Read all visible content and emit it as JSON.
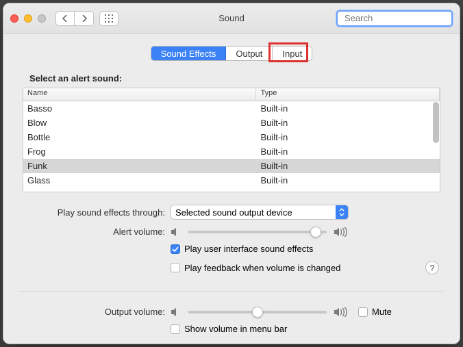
{
  "window": {
    "title": "Sound"
  },
  "search": {
    "placeholder": "Search"
  },
  "tabs": [
    "Sound Effects",
    "Output",
    "Input"
  ],
  "active_tab": 0,
  "highlight_tab": 2,
  "heading": "Select an alert sound:",
  "columns": {
    "name": "Name",
    "type": "Type"
  },
  "sounds": [
    {
      "name": "Basso",
      "type": "Built-in",
      "selected": false
    },
    {
      "name": "Blow",
      "type": "Built-in",
      "selected": false
    },
    {
      "name": "Bottle",
      "type": "Built-in",
      "selected": false
    },
    {
      "name": "Frog",
      "type": "Built-in",
      "selected": false
    },
    {
      "name": "Funk",
      "type": "Built-in",
      "selected": true
    },
    {
      "name": "Glass",
      "type": "Built-in",
      "selected": false
    }
  ],
  "labels": {
    "play_through": "Play sound effects through:",
    "alert_volume": "Alert volume:",
    "output_volume": "Output volume:"
  },
  "popup": {
    "selected": "Selected sound output device"
  },
  "alert_volume_pct": 92,
  "output_volume_pct": 50,
  "checkboxes": {
    "ui_effects": {
      "label": "Play user interface sound effects",
      "checked": true
    },
    "feedback": {
      "label": "Play feedback when volume is changed",
      "checked": false
    },
    "mute": {
      "label": "Mute",
      "checked": false
    },
    "menubar": {
      "label": "Show volume in menu bar",
      "checked": false
    }
  },
  "help": "?"
}
